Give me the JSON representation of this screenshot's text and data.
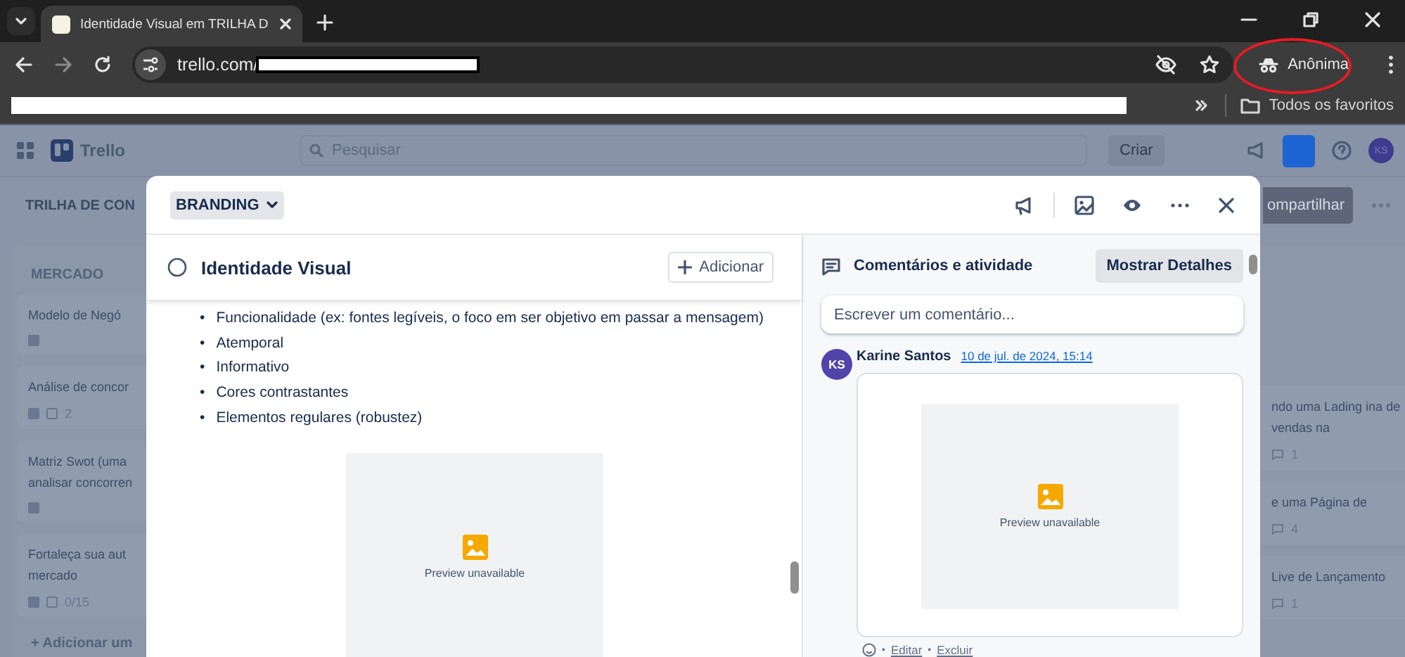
{
  "browser": {
    "tab_title": "Identidade Visual em TRILHA D",
    "url": "trello.com/",
    "profile": "Anônima",
    "bookmarks_folder": "Todos os favoritos"
  },
  "trello_header": {
    "logo": "Trello",
    "search_placeholder": "Pesquisar",
    "create": "Criar",
    "avatar": "KS"
  },
  "board": {
    "title": "TRILHA DE CON",
    "share": "ompartilhar",
    "left_list": {
      "name": "MERCADO",
      "cards": [
        {
          "title": "Modelo de Negó"
        },
        {
          "title": "Análise de concor",
          "meta": [
            "2"
          ]
        },
        {
          "title": "Matriz Swot (uma analisar concorren"
        },
        {
          "title": "Fortaleça sua aut mercado",
          "meta": [
            "0/15"
          ]
        }
      ],
      "add": "+ Adicionar um"
    },
    "right_list": {
      "cards": [
        {
          "title": "ndo uma Lading ina de vendas na",
          "meta": "1"
        },
        {
          "title": "e uma Página de",
          "meta": "4"
        },
        {
          "title": "Live de Lançamento",
          "meta": "1"
        }
      ]
    }
  },
  "card_modal": {
    "list": "BRANDING",
    "title": "Identidade Visual",
    "done": false,
    "add_button": "Adicionar",
    "description": {
      "marker": "•",
      "items": [
        "Funcionalidade (ex: fontes legíveis, o foco em ser objetivo em passar a mensagem)",
        "Atemporal",
        "Informativo",
        "Cores contrastantes",
        "Elementos regulares (robustez)"
      ]
    },
    "attachment": {
      "caption": "Preview unavailable"
    },
    "activity": {
      "heading": "Comentários e atividade",
      "details_button": "Mostrar Detalhes",
      "comment_placeholder": "Escrever um comentário...",
      "comments": [
        {
          "initials": "KS",
          "author": "Karine Santos",
          "date": "10 de jul. de 2024, 15:14",
          "preview_caption": "Preview unavailable",
          "action_separator": "•",
          "actions": [
            "Editar",
            "Excluir"
          ]
        }
      ]
    }
  }
}
